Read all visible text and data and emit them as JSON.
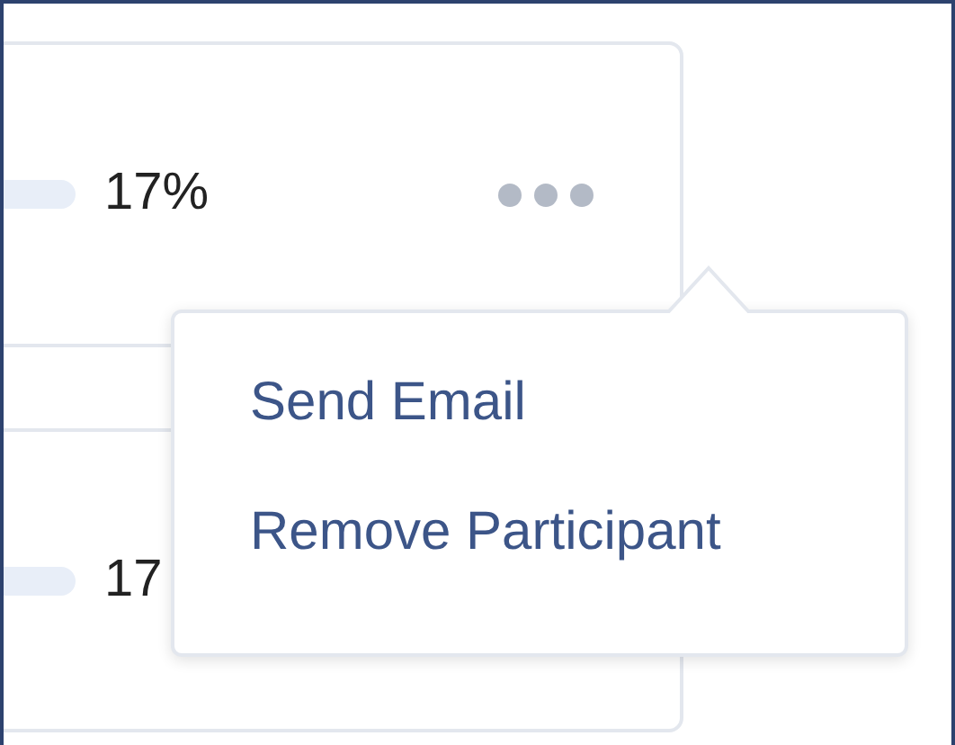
{
  "rows": [
    {
      "level": 0.17,
      "percent": "17%",
      "menu_open": true
    },
    {
      "level": 0.17,
      "percent": "17"
    }
  ],
  "menu": {
    "items": [
      {
        "label": "Send Email"
      },
      {
        "label": "Remove Participant"
      }
    ]
  }
}
